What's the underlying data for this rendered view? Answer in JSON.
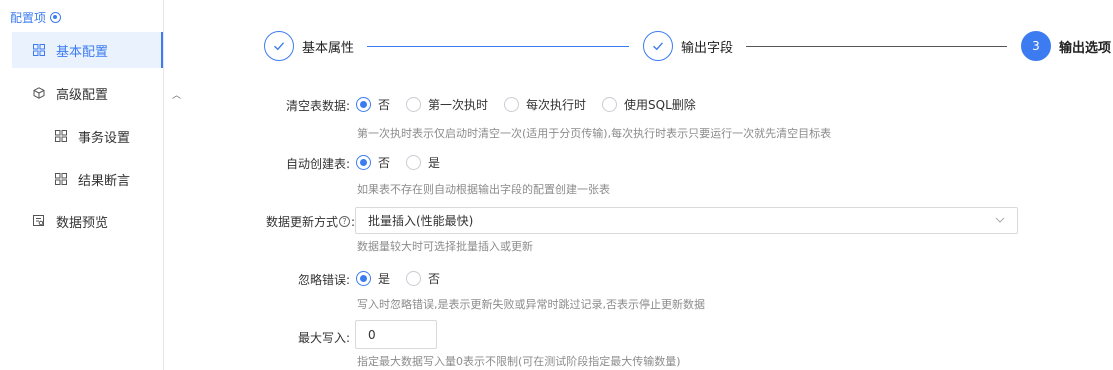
{
  "sidebar": {
    "header": "配置项",
    "items": [
      {
        "label": "基本配置",
        "icon": "grid-icon"
      },
      {
        "label": "高级配置",
        "icon": "cube-icon"
      },
      {
        "label": "事务设置",
        "icon": "grid-icon"
      },
      {
        "label": "结果断言",
        "icon": "grid-icon"
      },
      {
        "label": "数据预览",
        "icon": "preview-icon"
      }
    ]
  },
  "steps": [
    {
      "title": "基本属性",
      "state": "done"
    },
    {
      "title": "输出字段",
      "state": "done"
    },
    {
      "title": "输出选项",
      "state": "active",
      "number": "3"
    }
  ],
  "form": {
    "clear_table": {
      "label": "清空表数据:",
      "options": [
        "否",
        "第一次执时",
        "每次执行时",
        "使用SQL删除"
      ],
      "selected": "否",
      "hint": "第一次执时表示仅启动时清空一次(适用于分页传输),每次执行时表示只要运行一次就先清空目标表"
    },
    "auto_create": {
      "label": "自动创建表:",
      "options": [
        "否",
        "是"
      ],
      "selected": "否",
      "hint": "如果表不存在则自动根据输出字段的配置创建一张表"
    },
    "update_mode": {
      "label": "数据更新方式",
      "label_suffix": ":",
      "value": "批量插入(性能最快)",
      "hint": "数据量较大时可选择批量插入或更新"
    },
    "ignore_errors": {
      "label": "忽略错误:",
      "options": [
        "是",
        "否"
      ],
      "selected": "是",
      "hint": "写入时忽略错误,是表示更新失败或异常时跳过记录,否表示停止更新数据"
    },
    "max_write": {
      "label": "最大写入:",
      "value": "0",
      "hint": "指定最大数据写入量0表示不限制(可在测试阶段指定最大传输数量)"
    }
  },
  "colors": {
    "accent": "#3c7cf0",
    "hint": "#8c8c8c"
  }
}
